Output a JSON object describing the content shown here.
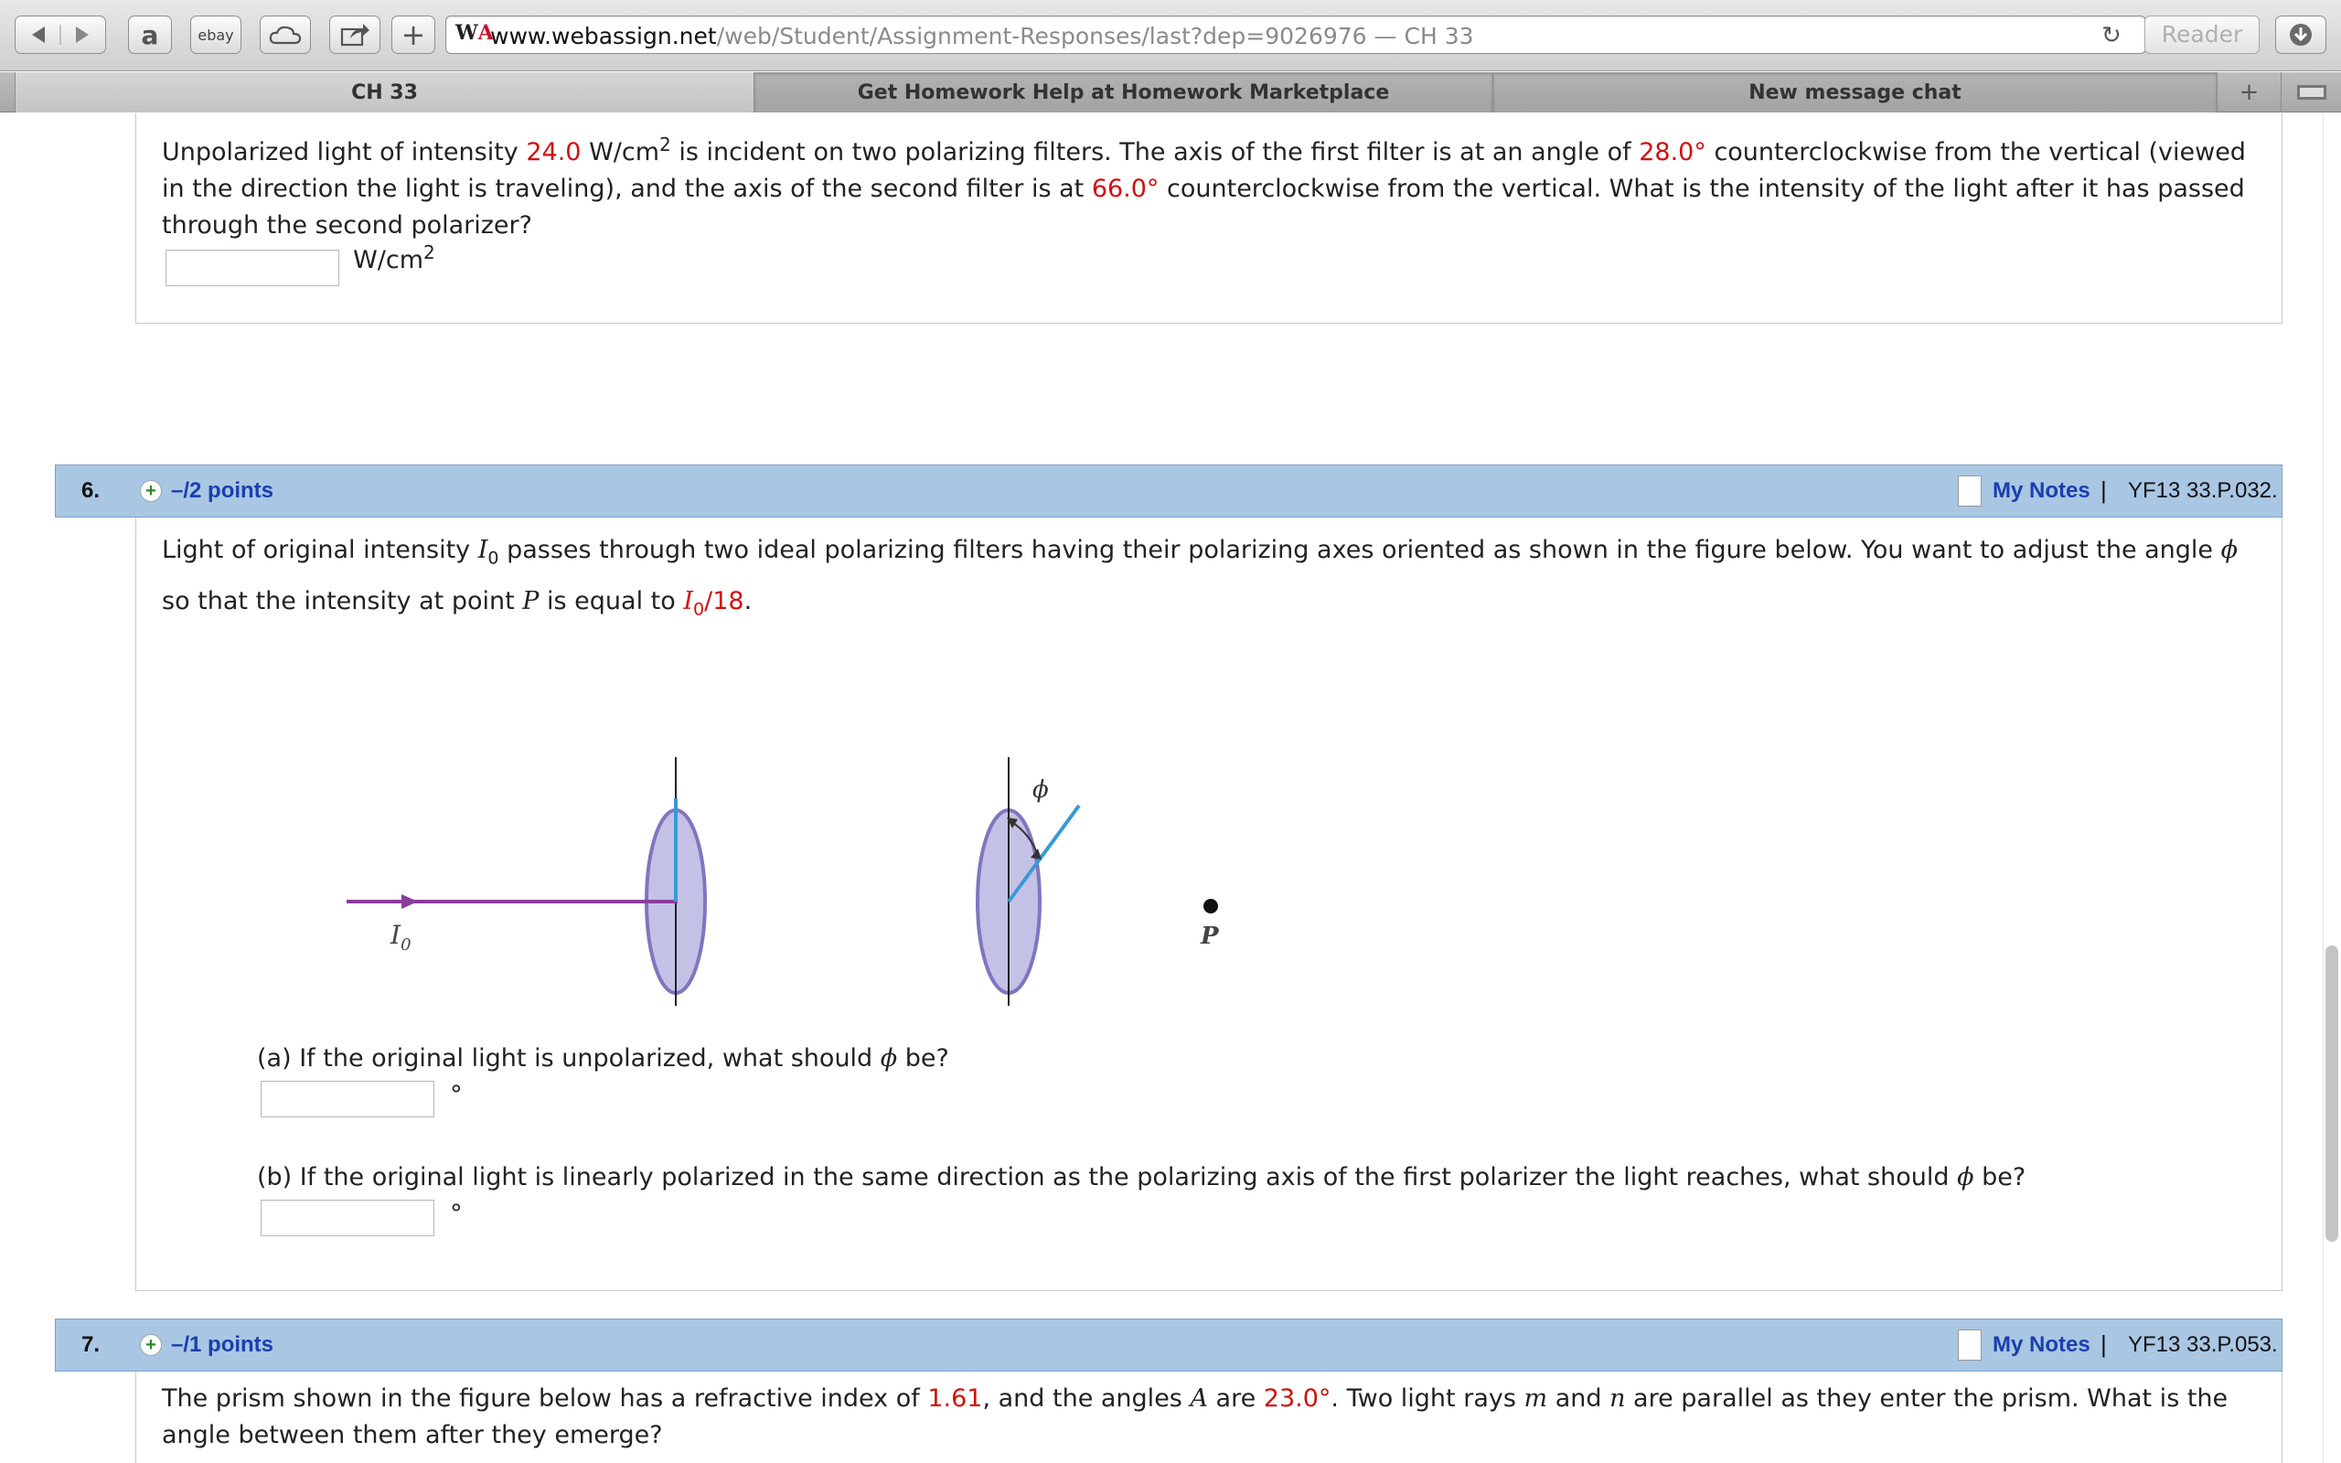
{
  "browser": {
    "url_host": "www.webassign.net",
    "url_path": "/web/Student/Assignment-Responses/last?dep=9026976",
    "url_suffix": " — CH 33",
    "reader_label": "Reader",
    "bookmarks": {
      "ebay_label": "ebay"
    },
    "tabs": [
      {
        "label": "CH 33"
      },
      {
        "label": "Get Homework Help at Homework Marketplace"
      },
      {
        "label": "New message chat"
      }
    ]
  },
  "q5": {
    "t1": "Unpolarized light of intensity ",
    "intensity": "24.0",
    "t2": " W/cm",
    "sup": "2",
    "t3": " is incident on two polarizing filters. The axis of the first filter is at an angle of ",
    "angle1": "28.0°",
    "t4": " counterclockwise from the vertical (viewed in the direction the light is traveling), and the axis of the second filter is at ",
    "angle2": "66.0°",
    "t5": " counterclockwise from the vertical. What is the intensity of the light after it has passed through the second polarizer?",
    "unit": "W/cm",
    "unit_sup": "2"
  },
  "q6": {
    "number": "6.",
    "points": "–/2 points",
    "notes": "My Notes",
    "sep": "|",
    "id": "YF13 33.P.032.",
    "t1": "Light of original intensity ",
    "I": "I",
    "sub0": "0",
    "t2": " passes through two ideal polarizing filters having their polarizing axes oriented as shown in the figure below. You want to adjust the angle ",
    "phi": "ϕ",
    "t3": " so that the intensity at point ",
    "P": "P",
    "t4": " is equal to ",
    "ratio": "/18",
    "t5": ".",
    "figure": {
      "source_label": "I",
      "source_sub": "0",
      "phi_label": "ϕ",
      "point_label": "P"
    },
    "a_t1": "(a) If the original light is unpolarized, what should ",
    "a_t2": " be?",
    "b_t1": "(b) If the original light is linearly polarized in the same direction as the polarizing axis of the first polarizer the light reaches, what should ",
    "b_t2": " be?",
    "deg": "°"
  },
  "q7": {
    "number": "7.",
    "points": "–/1 points",
    "notes": "My Notes",
    "sep": "|",
    "id": "YF13 33.P.053.",
    "t1": "The prism shown in the figure below has a refractive index of ",
    "n": "1.61",
    "t2": ", and the angles ",
    "A": "A",
    "t3": " are ",
    "angle": "23.0°",
    "t4": ". Two light rays ",
    "m": "m",
    "t5": " and ",
    "nn": "n",
    "t6": " are parallel as they enter the prism. What is the angle between them after they emerge?"
  },
  "colors": {
    "header_bg": "#a9c6e3",
    "link": "#1a3fae",
    "highlight": "#d01010"
  }
}
